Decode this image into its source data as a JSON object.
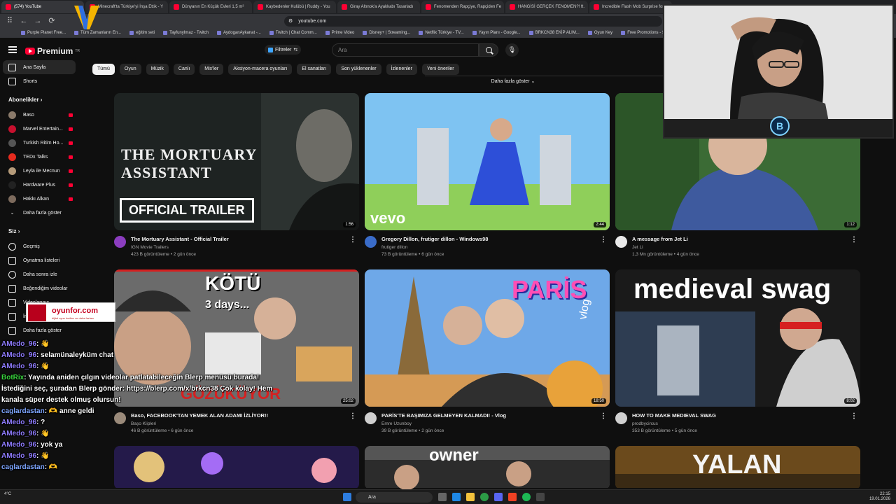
{
  "browser": {
    "tabs": [
      {
        "title": "(574) YouTube",
        "active": true
      },
      {
        "title": "Minecraft'ta Türkiye'yi İnşa Ettik - Y",
        "active": false
      },
      {
        "title": "Dünyanın En Küçük Evleri 1,5 m²",
        "active": false
      },
      {
        "title": "Kaybedenler Kulübü | Ruddy - You",
        "active": false
      },
      {
        "title": "Giray Altınok'a Ayakkabı Tasarladı",
        "active": false
      },
      {
        "title": "Fenomenden Rapçiye, Rapçiden Fe",
        "active": false
      },
      {
        "title": "HANGİSİ GERÇEK FENOMEN?! ft.",
        "active": false
      },
      {
        "title": "Incredible Flash Mob Surprise for",
        "active": false
      }
    ],
    "url": "youtube.com",
    "bookmarks": [
      "Purple Planet Free...",
      "Tüm Zamanların En...",
      "eğitim seti",
      "TayfunyImaz - Twitch",
      "AydoganAykanat -...",
      "Twitch | Chat Comm...",
      "Prime Video",
      "Disney+ | Streaming...",
      "Netflix Türkiye - TV...",
      "Yayın Planı - Google...",
      "BRKCN38 EKİP ALIM...",
      "Oyun Key",
      "Free Promotions - St..."
    ]
  },
  "header": {
    "logo_text": "Premium",
    "logo_sup": "TR",
    "filters_label": "Filtreler",
    "search_placeholder": "Ara"
  },
  "sidebar": {
    "main": [
      {
        "label": "Ana Sayfa",
        "icon": "home-icon",
        "active": true
      },
      {
        "label": "Shorts",
        "icon": "shorts-icon",
        "active": false
      }
    ],
    "subs_heading": "Abonelikler",
    "subs": [
      {
        "label": "Baso",
        "color": "#8a7a6a"
      },
      {
        "label": "Marvel Entertain...",
        "color": "#c8102e"
      },
      {
        "label": "Turkish Ritim Ho...",
        "color": "#555555"
      },
      {
        "label": "TEDx Talks",
        "color": "#e62b1e"
      },
      {
        "label": "Leyla ile Mecnun",
        "color": "#b59b7a"
      },
      {
        "label": "Hardware Plus",
        "color": "#222222"
      },
      {
        "label": "Hakkı Alkan",
        "color": "#7d6b5d"
      }
    ],
    "subs_more": "Daha fazla göster",
    "you_heading": "Siz",
    "you": [
      {
        "label": "Geçmiş",
        "icon": "history-icon"
      },
      {
        "label": "Oynatma listeleri",
        "icon": "playlist-icon"
      },
      {
        "label": "Daha sonra izle",
        "icon": "clock-icon"
      },
      {
        "label": "Beğendiğim videolar",
        "icon": "like-icon"
      },
      {
        "label": "Videolarınız",
        "icon": "video-icon"
      },
      {
        "label": "İndirilenler",
        "icon": "download-icon"
      },
      {
        "label": "Daha fazla göster",
        "icon": "chevron-down-icon"
      }
    ]
  },
  "chips": [
    "Tümü",
    "Oyun",
    "Müzik",
    "Canlı",
    "Mix'ler",
    "Aksiyon-macera oyunları",
    "El sanatları",
    "Son yüklenenler",
    "İzlenenler",
    "Yeni öneriler"
  ],
  "more_label": "Daha fazla göster",
  "videos": [
    {
      "title": "The Mortuary Assistant - Official Trailer",
      "channel": "IGN Movie Trailers",
      "stats": "423 B görüntüleme • 2 gün önce",
      "duration": "1:56",
      "thumb_title": "THE MORTUARY ASSISTANT",
      "thumb_badge": "OFFICIAL TRAILER",
      "avatar_color": "#8b3dbf"
    },
    {
      "title": "Gregory Dillon, frutiger dillon - Windows98",
      "channel": "frutiger dillon",
      "stats": "73 B görüntüleme • 6 gün önce",
      "duration": "2:44",
      "thumb_badge": "vevo",
      "avatar_color": "#3a6cc9"
    },
    {
      "title": "A message from Jet Li",
      "channel": "Jet Li",
      "stats": "1,3 Mn görüntüleme • 4 gün önce",
      "duration": "1:12",
      "avatar_color": "#e9e9e9"
    },
    {
      "title": "Baso, FACEBOOK'TAN YEMEK ALAN ADAMI İZLİYOR!!",
      "channel": "Başo Klipleri",
      "stats": "46 B görüntüleme • 6 gün önce",
      "duration": "25:02",
      "thumb_title": "KÖTÜ",
      "thumb_sub": "3 days...",
      "thumb_bottom": "GÖZÜKÜYOR",
      "avatar_color": "#9a8a7a"
    },
    {
      "title": "PARİS'TE BAŞIMIZA GELMEYEN KALMADI! - Vlog",
      "channel": "Emre Uzunboy",
      "stats": "39 B görüntüleme • 2 gün önce",
      "duration": "18:50",
      "thumb_title": "PARİS",
      "thumb_sub": "vlog",
      "avatar_color": "#cfcfcf"
    },
    {
      "title": "HOW TO MAKE MEDIEVAL SWAG",
      "channel": "prodbycircus",
      "stats": "353 B görüntüleme • 5 gün önce",
      "duration": "8:02",
      "thumb_title": "medieval swag",
      "avatar_color": "#d0d0d0"
    },
    {
      "title": "",
      "channel": "",
      "stats": "",
      "duration": "",
      "avatar_color": "#333333"
    },
    {
      "title": "",
      "channel": "",
      "stats": "",
      "duration": "",
      "thumb_title": "owner",
      "avatar_color": "#333333"
    },
    {
      "title": "",
      "channel": "",
      "stats": "",
      "duration": "",
      "thumb_title": "YALAN",
      "avatar_color": "#333333"
    }
  ],
  "chat": [
    {
      "user": "AMedo_96",
      "msg": ": 👋",
      "cls": "u1"
    },
    {
      "user": "AMedo_96",
      "msg": ": selamünaleyküm chat",
      "cls": "u1"
    },
    {
      "user": "AMedo_96",
      "msg": ": 👋",
      "cls": "u1"
    },
    {
      "user": "BotRix",
      "msg": ": Yayında aniden çılgın videolar patlatabileceğin Blerp menüsü burada! İstediğini seç, şuradan Blerp gönder: https://blerp.com/x/brkcn38 Çok kolay! Hem kanala süper destek olmuş olursun!",
      "cls": "u2"
    },
    {
      "user": "caglardastan",
      "msg": ": 🫶 anne geldi",
      "cls": "u3"
    },
    {
      "user": "AMedo_96",
      "msg": ": ?",
      "cls": "u1"
    },
    {
      "user": "AMedo_96",
      "msg": ": 👋",
      "cls": "u1"
    },
    {
      "user": "AMedo_96",
      "msg": ": yok ya",
      "cls": "u1"
    },
    {
      "user": "AMedo_96",
      "msg": ": 👋",
      "cls": "u1"
    },
    {
      "user": "caglardastan",
      "msg": ": 🫶",
      "cls": "u3"
    }
  ],
  "overlay": {
    "brand": "oyunfor.com",
    "brand_sub": "dijital oyun kodları ve daha fazlası"
  },
  "taskbar": {
    "search_label": "Ara",
    "weather": "4°C",
    "time": "22:15",
    "date": "19.01.2026"
  }
}
